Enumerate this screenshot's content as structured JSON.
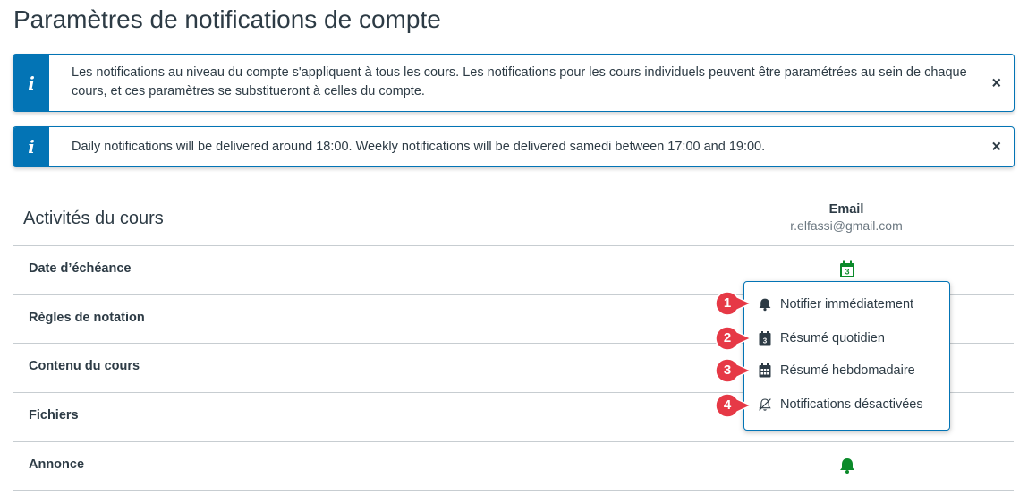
{
  "page": {
    "title": "Paramètres de notifications de compte"
  },
  "alerts": [
    {
      "icon": "info-icon",
      "icon_glyph": "i",
      "text": "Les notifications au niveau du compte s'appliquent à tous les cours. Les notifications pour les cours individuels peuvent être paramétrées au sein de chaque cours, et ces paramètres se substitueront à celles du compte.",
      "close": "×"
    },
    {
      "icon": "info-icon",
      "icon_glyph": "i",
      "text": "Daily notifications will be delivered around 18:00. Weekly notifications will be delivered samedi between 17:00 and 19:00.",
      "close": "×"
    }
  ],
  "section": {
    "title": "Activités du cours",
    "column_header": "Email",
    "column_subheader": "r.elfassi@gmail.com"
  },
  "rows": [
    {
      "label": "Date d’échéance",
      "setting_icon": "calendar-daily-icon",
      "calendar_number": "3"
    },
    {
      "label": "Règles de notation"
    },
    {
      "label": "Contenu du cours"
    },
    {
      "label": "Fichiers"
    },
    {
      "label": "Annonce",
      "setting_icon": "bell-icon"
    }
  ],
  "menu": {
    "items": [
      {
        "label": "Notifier immédiatement",
        "icon": "bell-icon"
      },
      {
        "label": "Résumé quotidien",
        "icon": "calendar-daily-icon",
        "calendar_number": "3"
      },
      {
        "label": "Résumé hebdomadaire",
        "icon": "calendar-weekly-icon"
      },
      {
        "label": "Notifications désactivées",
        "icon": "bell-off-icon"
      }
    ]
  },
  "step_markers": [
    "1",
    "2",
    "3",
    "4"
  ],
  "colors": {
    "accent": "#0374b5",
    "active_green": "#0b8a2a",
    "marker_red": "#e63946",
    "text": "#2d3b45"
  }
}
